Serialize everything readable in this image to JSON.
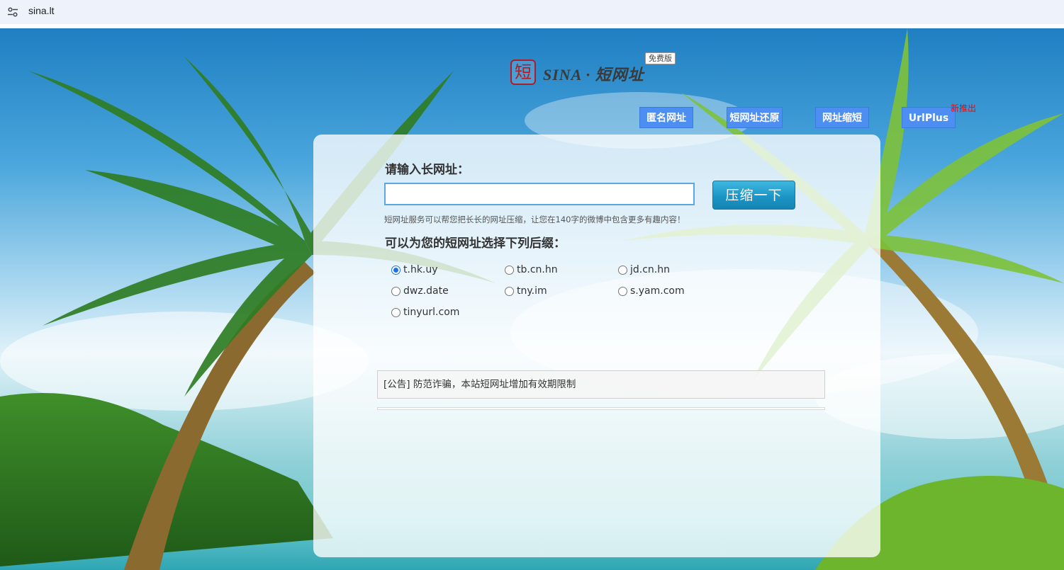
{
  "browser": {
    "address": "sina.lt",
    "tune_icon": "tune-icon"
  },
  "logo": {
    "seal_char": "短",
    "wordmark": "SINA · 短网址",
    "badge": "免费版",
    "color": "#b01c25"
  },
  "nav": {
    "items": [
      {
        "label": "匿名网址"
      },
      {
        "label": "短网址还原"
      },
      {
        "label": "网址缩短"
      },
      {
        "label": "UrlPlus",
        "badge": "新推出"
      }
    ],
    "color": "#4c8ef2"
  },
  "form": {
    "heading": "请输入长网址：",
    "input_value": "",
    "submit_label": "压缩一下",
    "hint": "短网址服务可以帮您把长长的网址压缩，让您在140字的微博中包含更多有趣内容！",
    "suffix_heading": "可以为您的短网址选择下列后缀：",
    "suffixes": [
      "t.hk.uy",
      "tb.cn.hn",
      "jd.cn.hn",
      "dwz.date",
      "tny.im",
      "s.yam.com",
      "tinyurl.com"
    ],
    "selected_suffix": "t.hk.uy",
    "accent": "#1c96c6"
  },
  "notice": {
    "text": "[公告] 防范诈骗，本站短网址增加有效期限制"
  }
}
